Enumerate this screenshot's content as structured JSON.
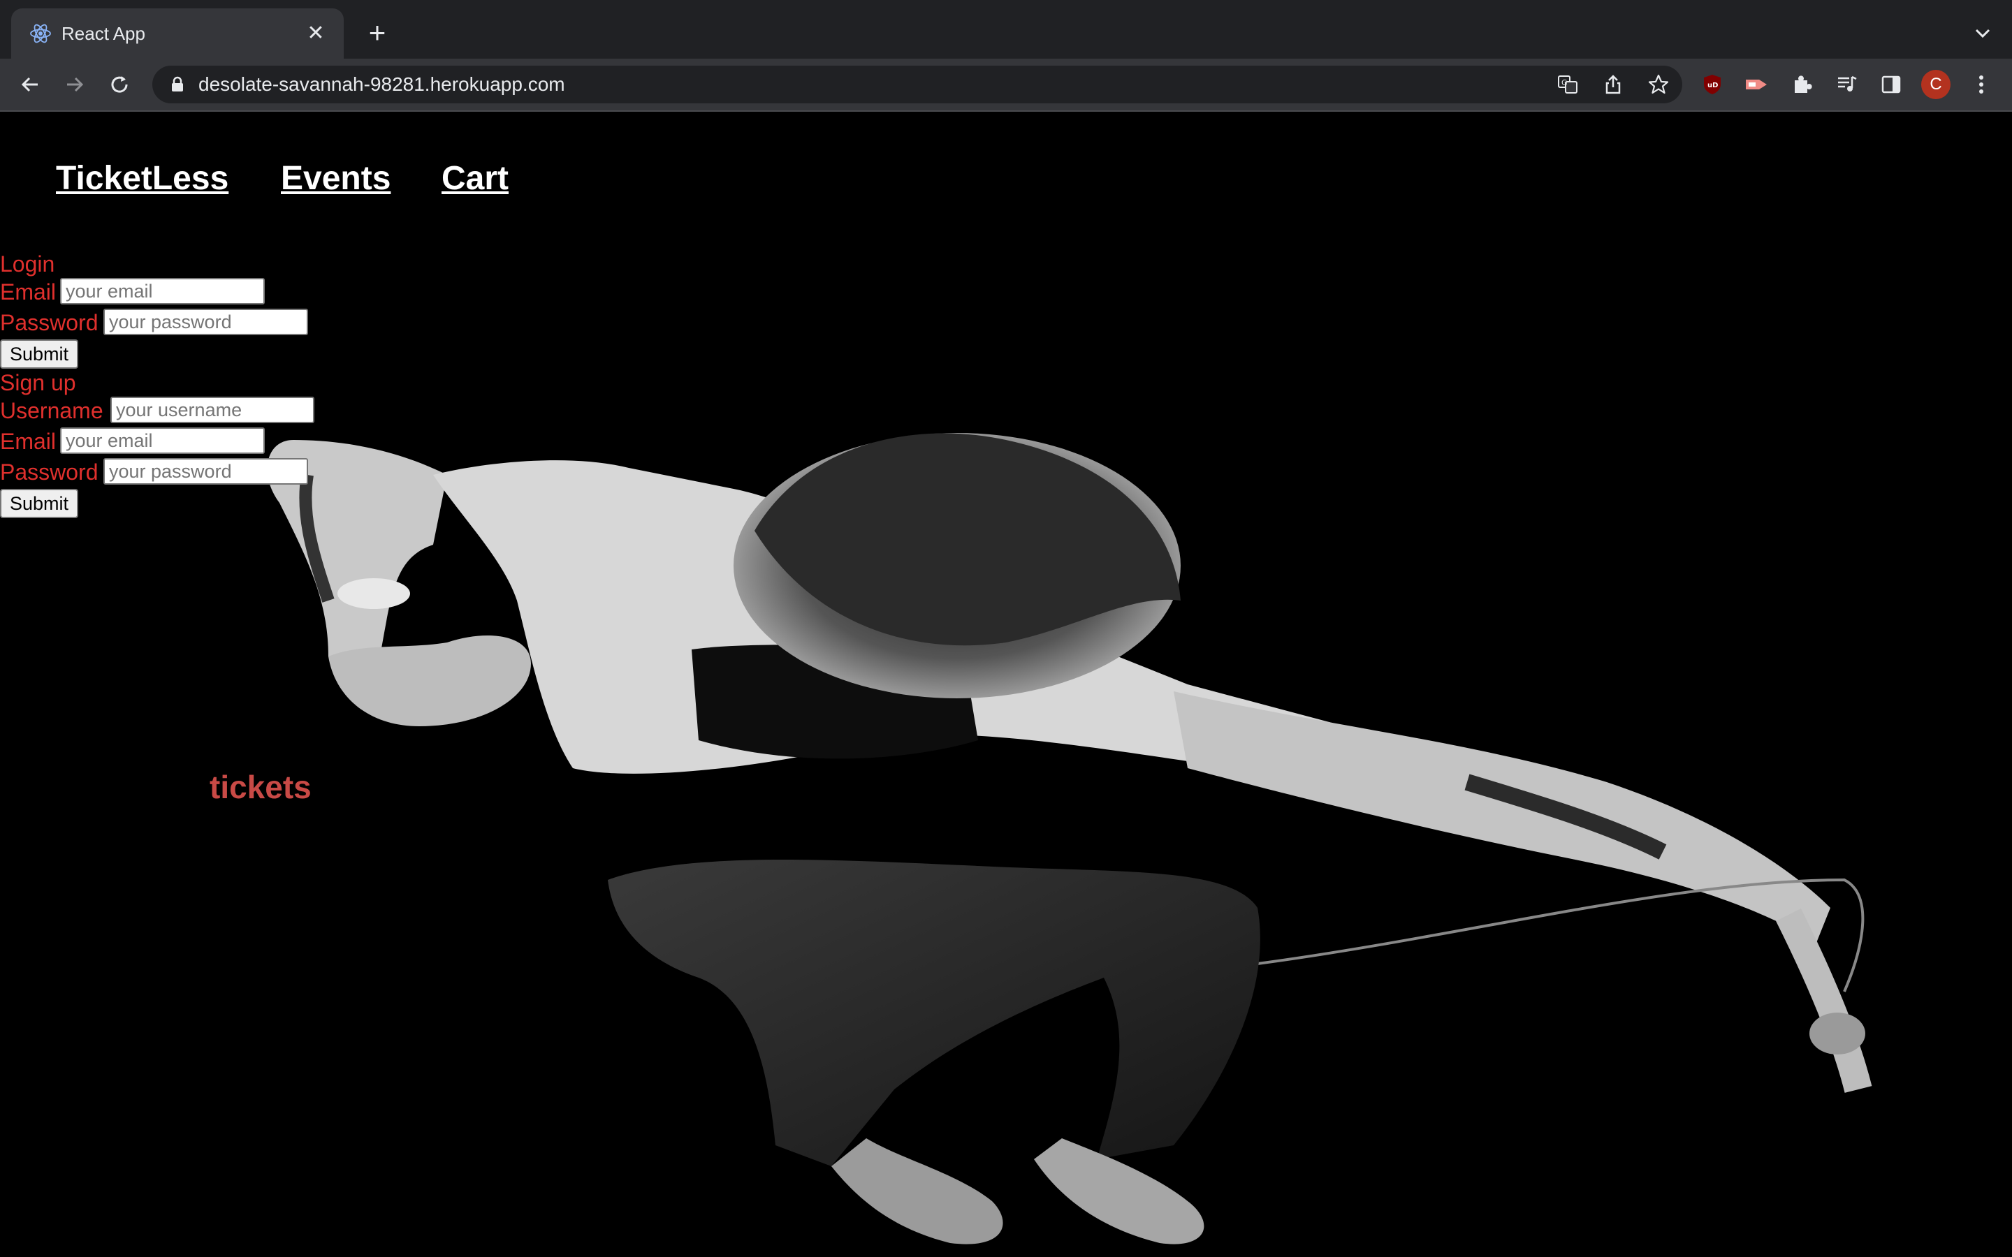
{
  "browser": {
    "tab_title": "React App",
    "url": "desolate-savannah-98281.herokuapp.com",
    "profile_initial": "C",
    "extension_badge_label": "uD"
  },
  "nav": {
    "brand": "TicketLess",
    "events": "Events",
    "cart": "Cart"
  },
  "login": {
    "heading": "Login",
    "email_label": "Email",
    "email_placeholder": "your email",
    "password_label": "Password",
    "password_placeholder": "your password",
    "submit_label": "Submit"
  },
  "signup": {
    "heading": "Sign up",
    "username_label": "Username",
    "username_placeholder": "your username",
    "email_label": "Email",
    "email_placeholder": "your email",
    "password_label": "Password",
    "password_placeholder": "your password",
    "submit_label": "Submit"
  },
  "hero": {
    "tagline": "tickets"
  },
  "colors": {
    "form_text": "#e0302d",
    "tagline": "#c94a46",
    "chrome_bg": "#202124",
    "toolbar_bg": "#35363a"
  },
  "icons": [
    "react-favicon-icon",
    "close-icon",
    "plus-icon",
    "chevron-down-icon",
    "back-arrow-icon",
    "forward-arrow-icon",
    "reload-icon",
    "lock-icon",
    "translate-icon",
    "share-icon",
    "star-icon",
    "ublock-icon",
    "cast-extension-icon",
    "puzzle-icon",
    "media-icon",
    "side-panel-icon",
    "kebab-menu-icon"
  ]
}
